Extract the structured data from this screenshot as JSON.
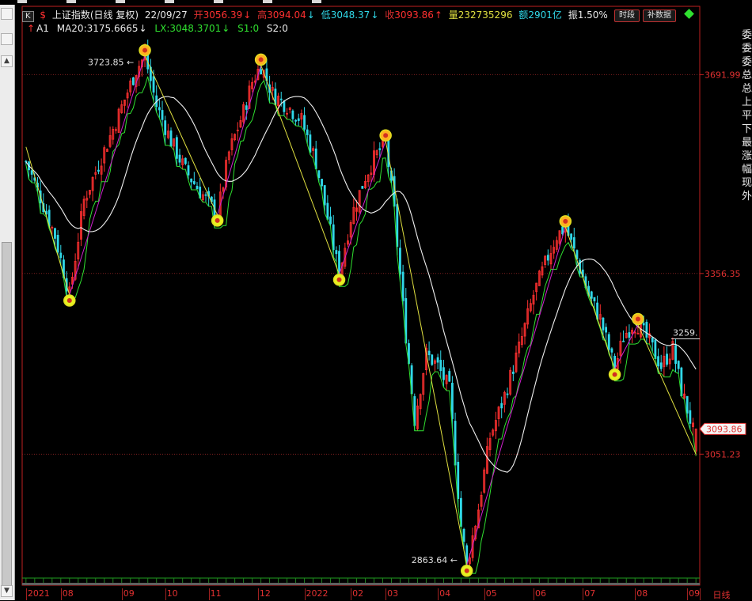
{
  "header": {
    "k_button": "K",
    "symbol_icon": "dollar-sign-icon",
    "title": "上证指数(日线  复权)",
    "date": "22/09/27",
    "open_label": "开",
    "open_value": "3056.39",
    "high_label": "高",
    "high_value": "3094.04",
    "low_label": "低",
    "low_value": "3048.37",
    "close_label": "收",
    "close_value": "3093.86",
    "volume_label": "量",
    "volume_value": "232735296",
    "amount_label": "额",
    "amount_value": "2901亿",
    "amplitude_label": "振",
    "amplitude_value": "1.50%",
    "time_button": "时段",
    "supplement_button": "补数据"
  },
  "indicators": {
    "name": "A1",
    "ma20_label": "MA20:",
    "ma20_value": "3175.6665",
    "lx_label": "LX:",
    "lx_value": "3048.3701",
    "s1_label": "S1:",
    "s1_value": "0",
    "s2_label": "S2:",
    "s2_value": "0"
  },
  "right_panel": [
    "委",
    "委",
    "委",
    "总",
    "总",
    "上",
    "平",
    "下",
    "最",
    "涨",
    "幅",
    "现",
    "外"
  ],
  "colors": {
    "up": "#ff3030",
    "down": "#30d8e8",
    "ma": "#f0f0f0",
    "lx": "#30e030",
    "zig_up": "#d020d0",
    "zig_down": "#e0e040",
    "axis": "#c02020",
    "label": "#e03030",
    "marker_fill": "#e8f020",
    "marker_top": "#ffb020"
  },
  "chart_data": {
    "type": "candlestick",
    "title": "上证指数(日线  复权)",
    "y_axis": {
      "min": 2830,
      "max": 3770,
      "ticks": [
        3691.99,
        3356.35,
        3051.23
      ],
      "current_price_label": "3093.86",
      "last_level_label": "3259."
    },
    "x_axis": {
      "labels": [
        "2021",
        "08",
        "09",
        "10",
        "11",
        "12",
        "2022",
        "02",
        "03",
        "04",
        "05",
        "06",
        "07",
        "08",
        "09"
      ],
      "label_index": [
        0,
        12,
        33,
        48,
        63,
        80,
        96,
        112,
        124,
        142,
        158,
        175,
        192,
        210,
        228
      ],
      "end_label": "日线"
    },
    "annotations": {
      "high": {
        "label": "3723.85",
        "index": 41,
        "value": 3723.85
      },
      "low": {
        "label": "2863.64",
        "index": 152,
        "value": 2863.64
      }
    },
    "zigzag": [
      {
        "index": 0,
        "value": 3570,
        "type": "start"
      },
      {
        "index": 15,
        "value": 3320,
        "type": "bottom"
      },
      {
        "index": 41,
        "value": 3723.85,
        "type": "top"
      },
      {
        "index": 66,
        "value": 3455,
        "type": "bottom"
      },
      {
        "index": 81,
        "value": 3708,
        "type": "top"
      },
      {
        "index": 108,
        "value": 3355,
        "type": "bottom"
      },
      {
        "index": 124,
        "value": 3580,
        "type": "top"
      },
      {
        "index": 152,
        "value": 2863.64,
        "type": "bottom"
      },
      {
        "index": 186,
        "value": 3435,
        "type": "top"
      },
      {
        "index": 203,
        "value": 3195,
        "type": "bottom"
      },
      {
        "index": 211,
        "value": 3270,
        "type": "top"
      },
      {
        "index": 231,
        "value": 3051.23,
        "type": "end"
      }
    ],
    "trend_anchors": [
      [
        0,
        3545
      ],
      [
        5,
        3485
      ],
      [
        10,
        3420
      ],
      [
        15,
        3320
      ],
      [
        20,
        3480
      ],
      [
        25,
        3540
      ],
      [
        30,
        3600
      ],
      [
        34,
        3650
      ],
      [
        38,
        3700
      ],
      [
        41,
        3723.85
      ],
      [
        45,
        3640
      ],
      [
        50,
        3580
      ],
      [
        55,
        3530
      ],
      [
        60,
        3495
      ],
      [
        66,
        3455
      ],
      [
        70,
        3560
      ],
      [
        75,
        3630
      ],
      [
        78,
        3680
      ],
      [
        81,
        3708
      ],
      [
        85,
        3660
      ],
      [
        90,
        3640
      ],
      [
        95,
        3615
      ],
      [
        100,
        3545
      ],
      [
        104,
        3450
      ],
      [
        108,
        3355
      ],
      [
        112,
        3450
      ],
      [
        117,
        3520
      ],
      [
        120,
        3550
      ],
      [
        124,
        3580
      ],
      [
        127,
        3460
      ],
      [
        130,
        3300
      ],
      [
        134,
        3110
      ],
      [
        138,
        3220
      ],
      [
        142,
        3200
      ],
      [
        146,
        3160
      ],
      [
        150,
        2930
      ],
      [
        152,
        2863.64
      ],
      [
        156,
        2960
      ],
      [
        160,
        3080
      ],
      [
        165,
        3150
      ],
      [
        170,
        3230
      ],
      [
        175,
        3320
      ],
      [
        180,
        3385
      ],
      [
        183,
        3420
      ],
      [
        186,
        3435
      ],
      [
        190,
        3380
      ],
      [
        194,
        3320
      ],
      [
        198,
        3280
      ],
      [
        203,
        3195
      ],
      [
        206,
        3250
      ],
      [
        209,
        3270
      ],
      [
        211,
        3270
      ],
      [
        215,
        3240
      ],
      [
        219,
        3200
      ],
      [
        223,
        3230
      ],
      [
        226,
        3160
      ],
      [
        229,
        3110
      ],
      [
        231,
        3070
      ]
    ],
    "candles_last": {
      "open": 3056.39,
      "high": 3094.04,
      "low": 3048.37,
      "close": 3093.86
    },
    "count": 232
  }
}
